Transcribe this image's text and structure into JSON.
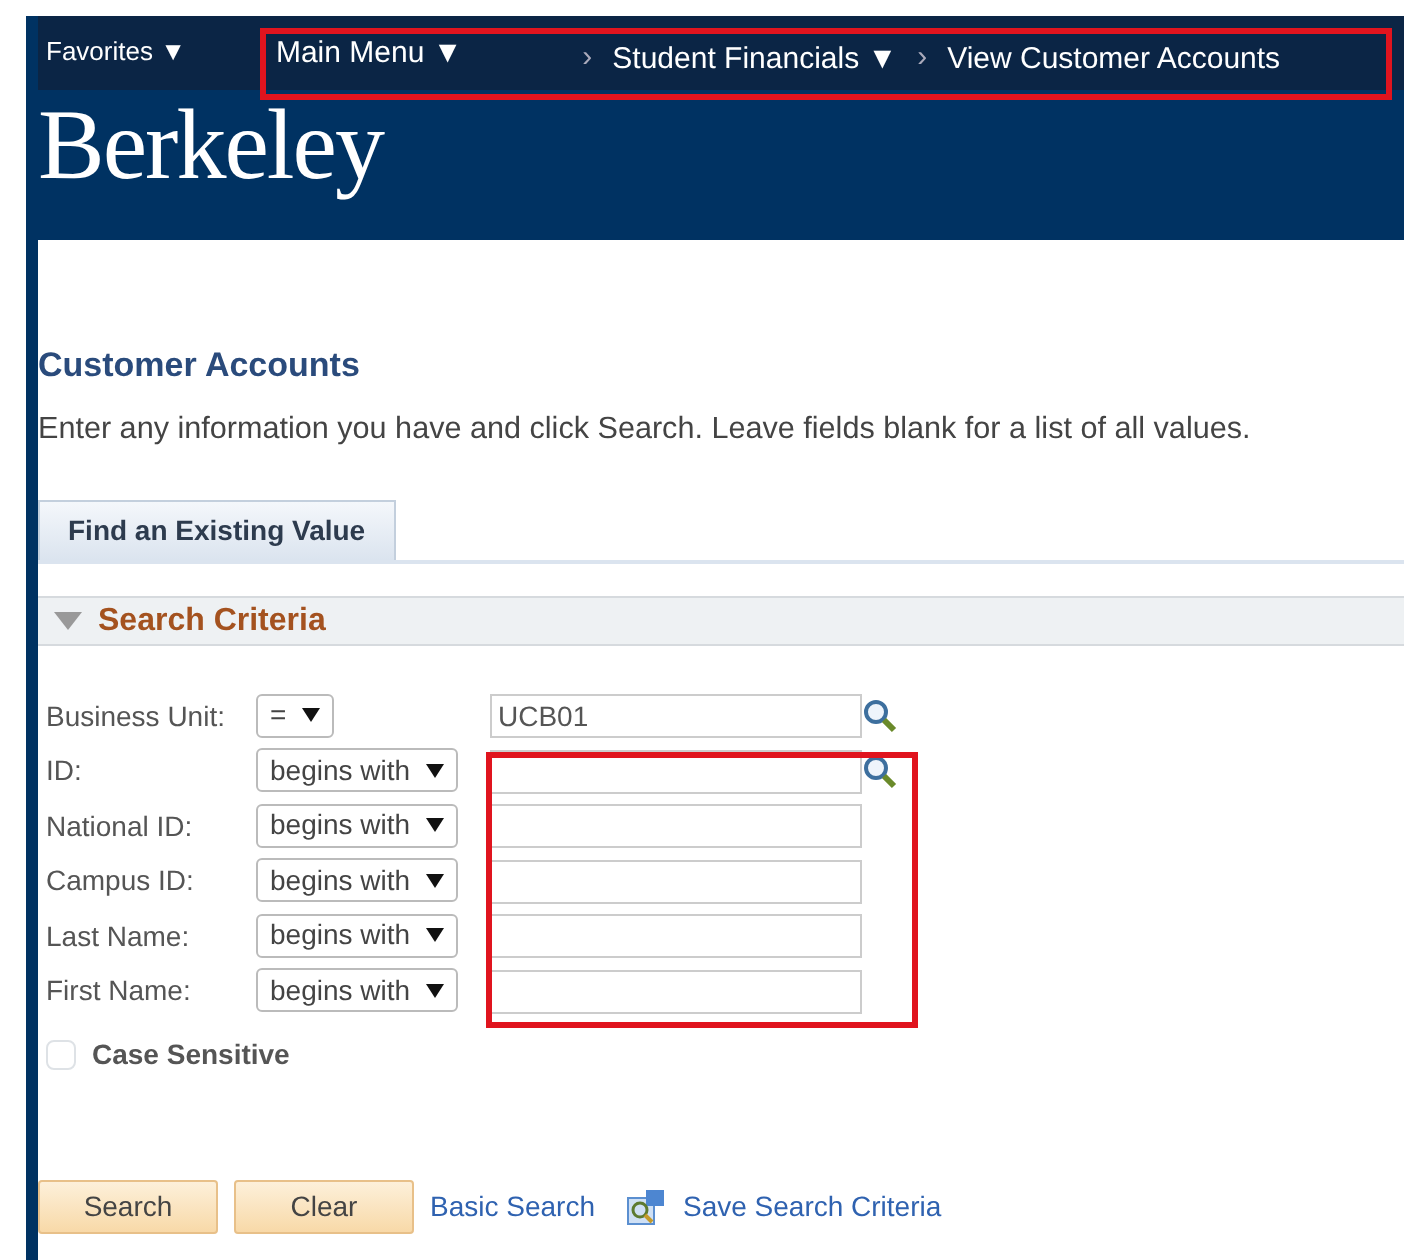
{
  "top_nav": {
    "favorites": {
      "label": "Favorites",
      "caret": "▼"
    },
    "breadcrumb": {
      "highlighted": true,
      "items": [
        {
          "label": "Main Menu",
          "caret": "▼"
        },
        {
          "label": "Student Financials",
          "caret": "▼"
        },
        {
          "label": "View Customer Accounts"
        }
      ]
    },
    "separator": "›"
  },
  "brand": "Berkeley",
  "page": {
    "title": "Customer Accounts",
    "instructions": "Enter any information you have and click Search. Leave fields blank for a list of all values."
  },
  "tabs": [
    {
      "label": "Find an Existing Value",
      "selected": true
    }
  ],
  "search_criteria": {
    "title": "Search Criteria",
    "expanded": true,
    "fields_highlighted": true,
    "rows": [
      {
        "label": "Business Unit:",
        "operator": "=",
        "value": "UCB01",
        "lookup": true
      },
      {
        "label": "ID:",
        "operator": "begins with",
        "lookup": true
      },
      {
        "label": "National ID:",
        "operator": "begins with",
        "lookup": false
      },
      {
        "label": "Campus ID:",
        "operator": "begins with",
        "lookup": false
      },
      {
        "label": "Last Name:",
        "operator": "begins with",
        "lookup": false
      },
      {
        "label": "First Name:",
        "operator": "begins with",
        "lookup": false
      }
    ],
    "case_sensitive": {
      "label": "Case Sensitive",
      "checked": false
    }
  },
  "actions": {
    "buttons": [
      "Search",
      "Clear"
    ],
    "links": [
      {
        "label": "Basic Search",
        "icon": false
      },
      {
        "label": "Save Search Criteria",
        "icon": true
      }
    ]
  }
}
